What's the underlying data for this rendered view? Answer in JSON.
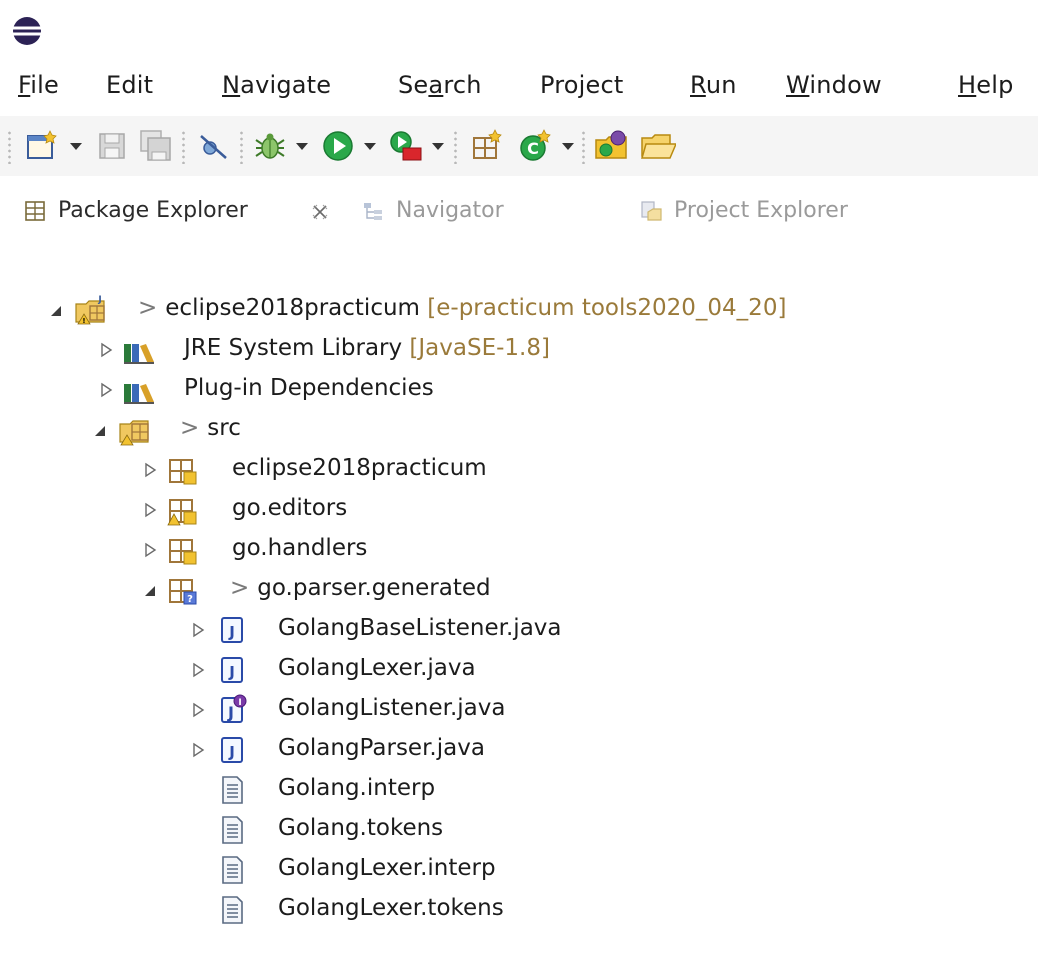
{
  "window": {
    "title_fragment": ""
  },
  "menubar": {
    "items": [
      {
        "pre": "",
        "mnemonic": "F",
        "post": "ile"
      },
      {
        "pre": "Edit",
        "mnemonic": "",
        "post": ""
      },
      {
        "pre": "",
        "mnemonic": "N",
        "post": "avigate"
      },
      {
        "pre": "Se",
        "mnemonic": "a",
        "post": "rch"
      },
      {
        "pre": "Project",
        "mnemonic": "",
        "post": ""
      },
      {
        "pre": "",
        "mnemonic": "R",
        "post": "un"
      },
      {
        "pre": "",
        "mnemonic": "W",
        "post": "indow"
      },
      {
        "pre": "",
        "mnemonic": "H",
        "post": "elp"
      }
    ]
  },
  "toolbar": {
    "buttons": [
      "new-wizard-icon",
      "save-icon",
      "save-all-icon",
      "skip-breakpoints-icon",
      "debug-icon",
      "run-icon",
      "external-tools-icon",
      "new-java-package-icon",
      "new-java-class-icon",
      "open-type-icon",
      "open-folder-icon"
    ]
  },
  "tabs": [
    {
      "label": "Package Explorer",
      "active": true,
      "icon": "package-explorer-icon"
    },
    {
      "label": "Navigator",
      "active": false,
      "icon": "navigator-icon"
    },
    {
      "label": "Project Explorer",
      "active": false,
      "icon": "project-explorer-icon"
    }
  ],
  "tree": {
    "project": {
      "name": "eclipse2018practicum",
      "decoration": "[e-practicum tools2020_04_20]"
    },
    "jre": {
      "name": "JRE System Library",
      "decoration": "[JavaSE-1.8]"
    },
    "plugin_deps": {
      "name": "Plug-in Dependencies"
    },
    "src": {
      "name": "src"
    },
    "packages": [
      {
        "name": "eclipse2018practicum"
      },
      {
        "name": "go.editors"
      },
      {
        "name": "go.handlers"
      },
      {
        "name": "go.parser.generated"
      }
    ],
    "java_files": [
      {
        "name": "GolangBaseListener.java"
      },
      {
        "name": "GolangLexer.java"
      },
      {
        "name": "GolangListener.java"
      },
      {
        "name": "GolangParser.java"
      }
    ],
    "text_files": [
      {
        "name": "Golang.interp"
      },
      {
        "name": "Golang.tokens"
      },
      {
        "name": "GolangLexer.interp"
      },
      {
        "name": "GolangLexer.tokens"
      }
    ],
    "marker": ">"
  },
  "colors": {
    "accent_blue": "#1f3a94",
    "warning_yellow": "#f2c230",
    "error_red": "#d9262c",
    "run_green": "#2aa84a"
  }
}
